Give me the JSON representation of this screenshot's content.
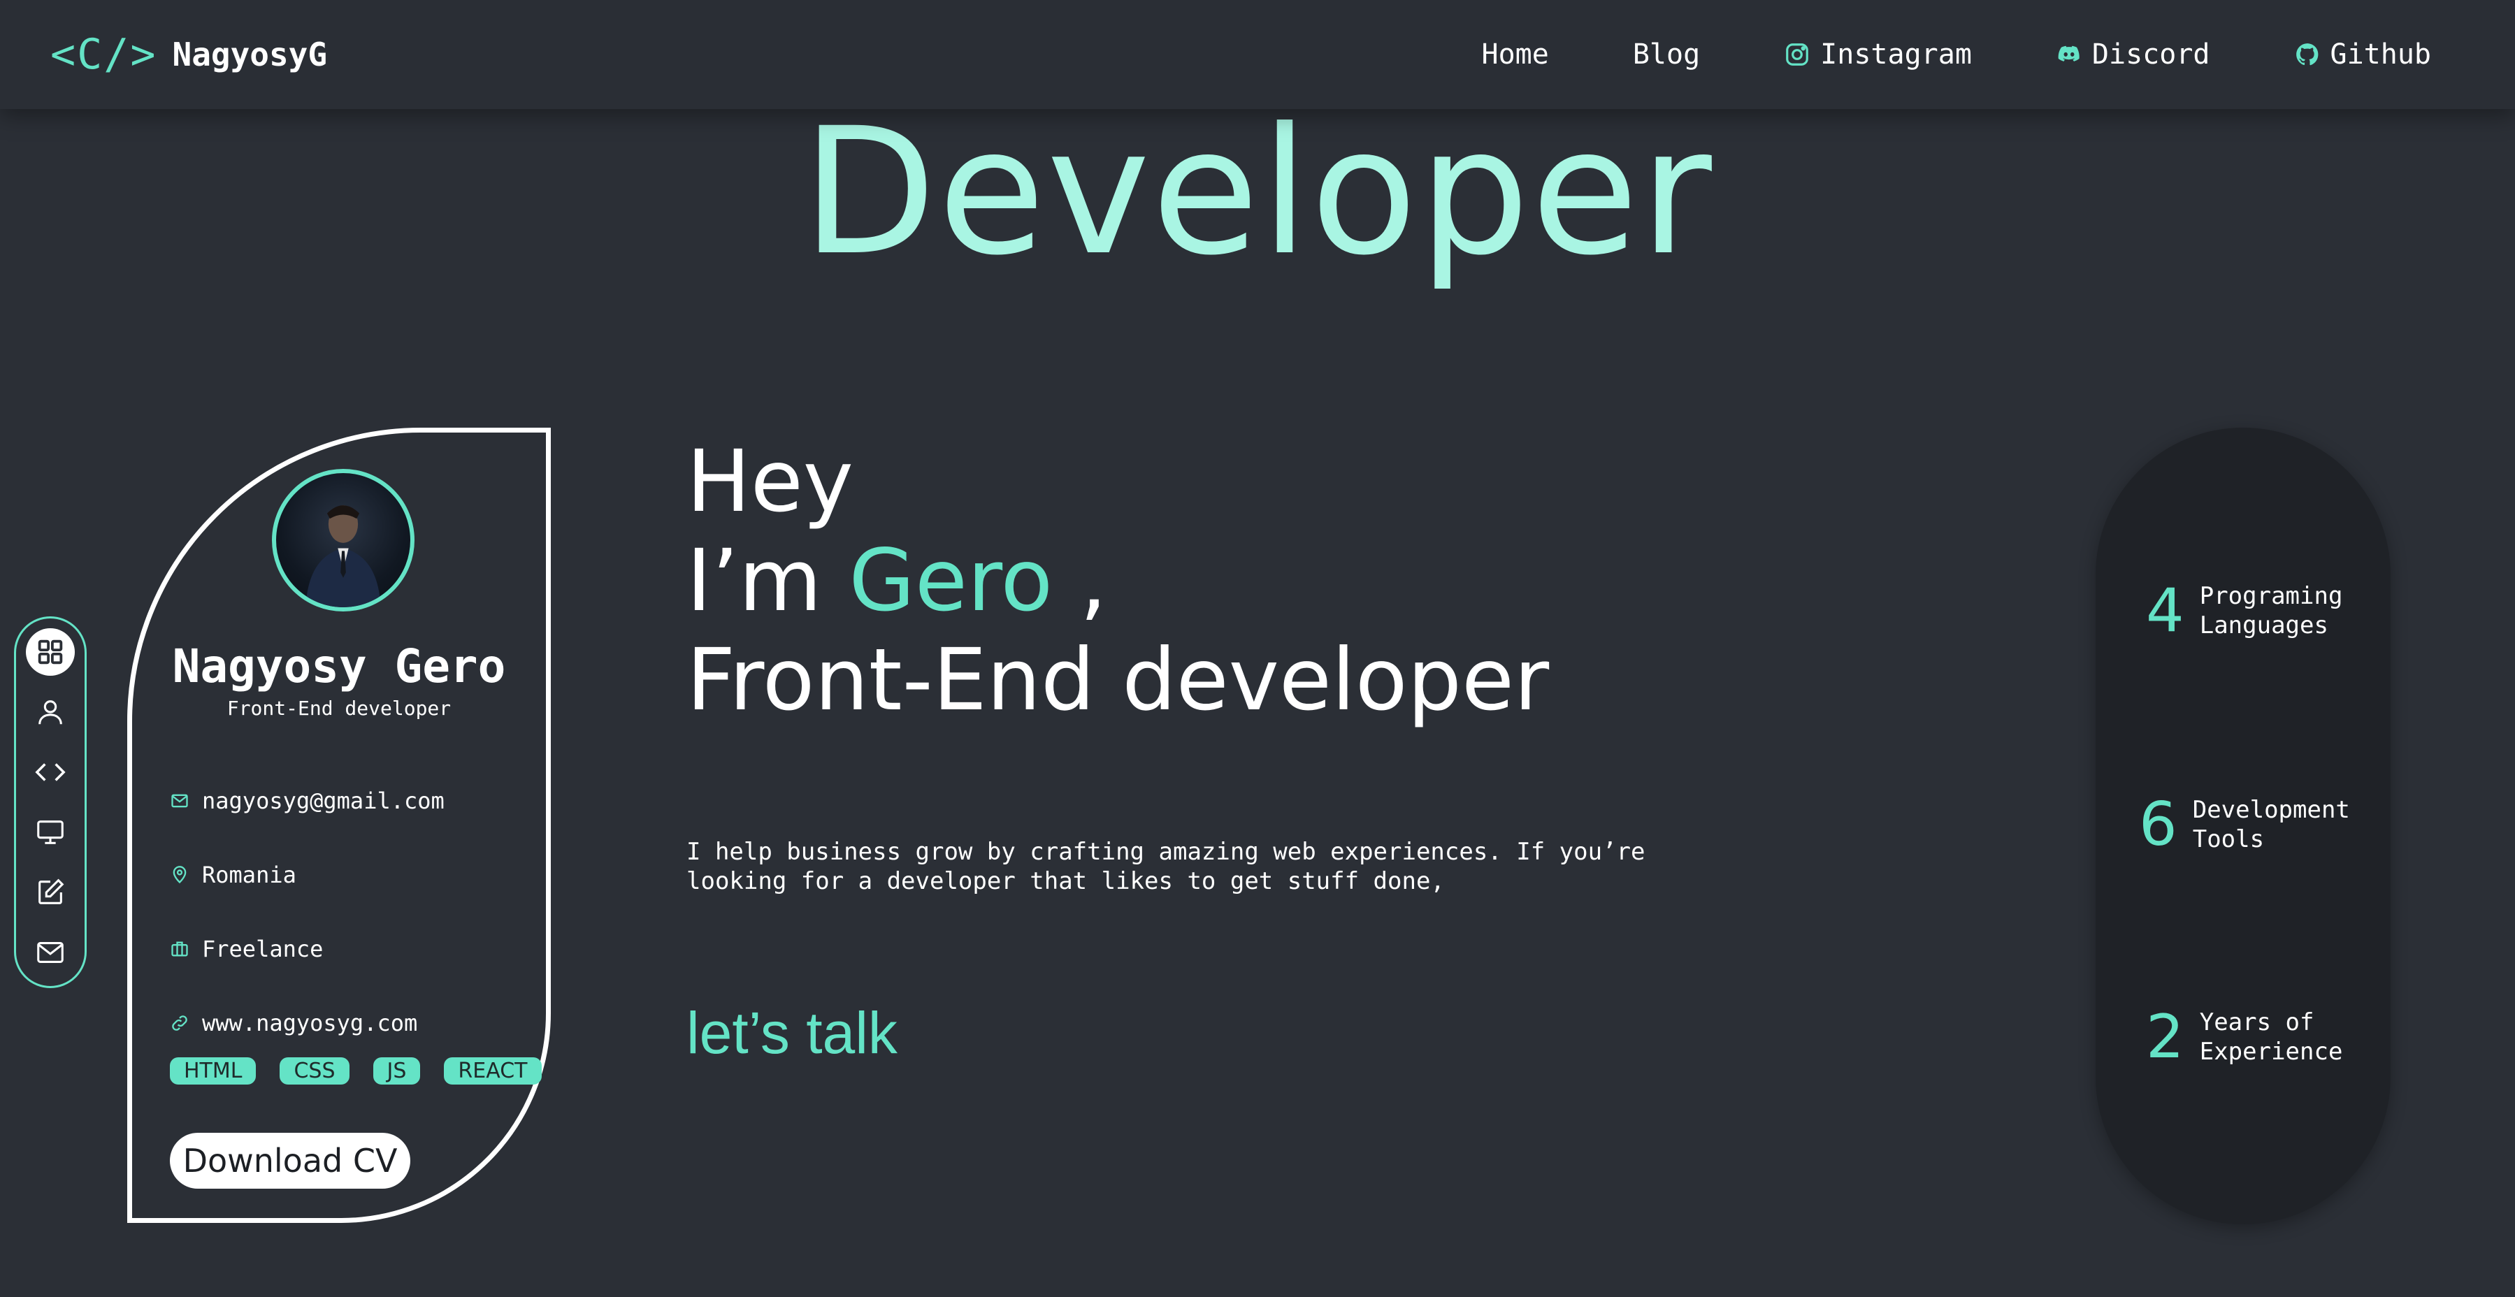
{
  "header": {
    "logo_mark": "<C/>",
    "logo_name": "NagyosyG",
    "nav": [
      {
        "label": "Home",
        "icon": ""
      },
      {
        "label": "Blog",
        "icon": ""
      },
      {
        "label": "Instagram",
        "icon": "instagram-icon"
      },
      {
        "label": "Discord",
        "icon": "discord-icon"
      },
      {
        "label": "Github",
        "icon": "github-icon"
      }
    ]
  },
  "hero": {
    "title": "Developer"
  },
  "side_nav": {
    "items": [
      "grid-icon",
      "user-icon",
      "code-icon",
      "monitor-icon",
      "edit-icon",
      "mail-icon"
    ],
    "active": "grid-icon"
  },
  "profile": {
    "name": "Nagyosy Gero",
    "role": "Front-End developer",
    "email": "nagyosyg@gmail.com",
    "location": "Romania",
    "work": "Freelance",
    "website": "www.nagyosyg.com",
    "tags": [
      "HTML",
      "CSS",
      "JS",
      "REACT"
    ],
    "download_label": "Download CV"
  },
  "main": {
    "line1": "Hey",
    "line2_prefix": "I’m ",
    "line2_name": "Gero",
    "line2_suffix": " ,",
    "line3": "Front-End developer",
    "intro": "I help business grow by crafting amazing web experiences. If you’re looking for a developer that likes to get stuff done,",
    "cta": "let’s talk"
  },
  "stats": [
    {
      "number": "4",
      "label": "Programing Languages"
    },
    {
      "number": "6",
      "label": "Development Tools"
    },
    {
      "number": "2",
      "label": "Years of Experience"
    }
  ],
  "colors": {
    "background": "#2b2f36",
    "accent": "#64e3c6",
    "hero_title": "#a9f5e3",
    "stats_panel": "#1f2227"
  }
}
